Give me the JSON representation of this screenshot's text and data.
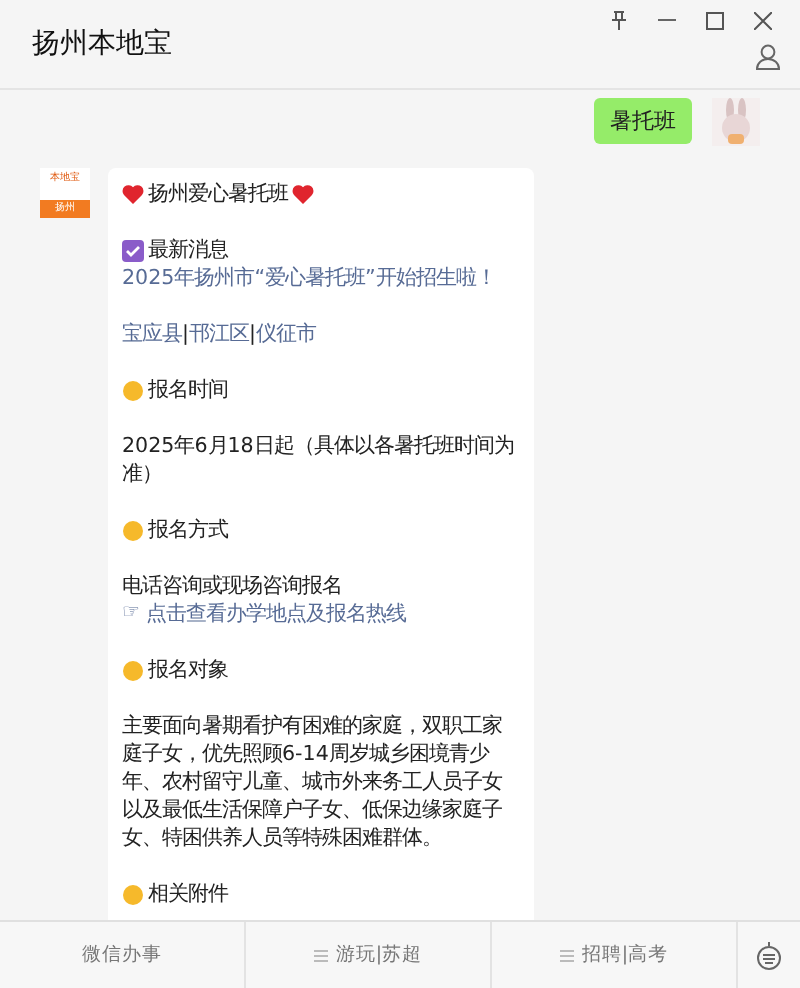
{
  "window": {
    "title": "扬州本地宝"
  },
  "sent": {
    "text": "暑托班"
  },
  "logo": {
    "brand": "本地宝",
    "city": "扬州"
  },
  "message": {
    "paragraphs": [
      [
        {
          "kind": "title",
          "text": "扬州爱心暑托班"
        }
      ],
      [
        {
          "kind": "notice",
          "text": "最新消息"
        },
        {
          "kind": "link",
          "text": "2025年扬州市“爱心暑托班”开始招生啦！"
        }
      ],
      [
        {
          "kind": "links",
          "items": [
            "宝应县",
            "邗江区",
            "仪征市"
          ],
          "separator": "|"
        }
      ],
      [
        {
          "kind": "heading",
          "text": "报名时间"
        }
      ],
      [
        {
          "kind": "text",
          "text": "2025年6月18日起（具体以各暑托班时间为准）"
        }
      ],
      [
        {
          "kind": "heading",
          "text": "报名方式"
        }
      ],
      [
        {
          "kind": "text",
          "text": "电话咨询或现场咨询报名"
        },
        {
          "kind": "pointer-link",
          "pointer": "☞",
          "text": "点击查看办学地点及报名热线"
        }
      ],
      [
        {
          "kind": "heading",
          "text": "报名对象"
        }
      ],
      [
        {
          "kind": "text",
          "text": "主要面向暑期看护有困难的家庭，双职工家庭子女，优先照顾6-14周岁城乡困境青少年、农村留守儿童、城市外来务工人员子女以及最低生活保障户子女、低保边缘家庭子女、特困供养人员等特殊困难群体。"
        }
      ],
      [
        {
          "kind": "heading",
          "text": "相关附件"
        }
      ]
    ]
  },
  "menu": [
    {
      "label": "微信办事",
      "submenu": false
    },
    {
      "label": "游玩|苏超",
      "submenu": true
    },
    {
      "label": "招聘|高考",
      "submenu": true
    }
  ]
}
